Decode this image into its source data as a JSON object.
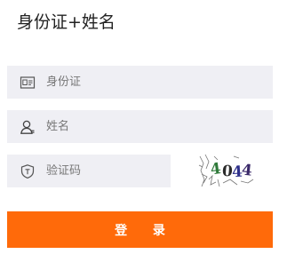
{
  "header": {
    "title": "身份证+姓名"
  },
  "form": {
    "id_card": {
      "placeholder": "身份证",
      "icon": "id-card-icon",
      "value": ""
    },
    "name": {
      "placeholder": "姓名",
      "icon": "user-icon",
      "value": ""
    },
    "captcha": {
      "placeholder": "验证码",
      "icon": "shield-icon",
      "value": ""
    }
  },
  "captcha_image": {
    "text": "4044",
    "colors": [
      "#2f7a3a",
      "#2a2a2a",
      "#2d2f8a",
      "#3b2a6a"
    ]
  },
  "login_button": {
    "label": "登 录",
    "color": "#ff6a0a"
  },
  "colors": {
    "input_bg": "#efeff4",
    "text": "#222222"
  }
}
